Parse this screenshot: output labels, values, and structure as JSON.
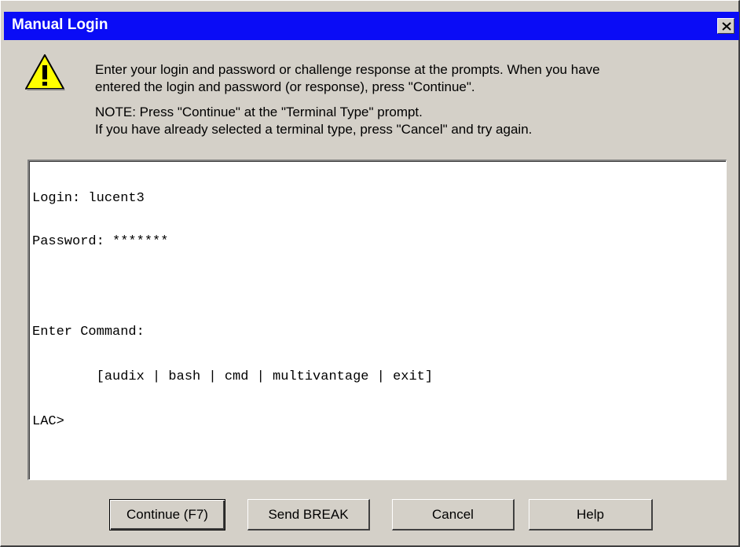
{
  "window": {
    "title": "Manual Login",
    "close_icon": "close-x-icon"
  },
  "message": {
    "icon": "warning-icon",
    "line1": "Enter your login and password or challenge response at the prompts. When you have",
    "line2": "entered the login and password (or response), press \"Continue\".",
    "line3": "NOTE: Press \"Continue\" at the \"Terminal Type\" prompt.",
    "line4": "If you have already selected a terminal type, press \"Cancel\" and try again."
  },
  "terminal": {
    "lines": [
      "Login: lucent3",
      "Password: *******",
      "Enter Command:",
      "        [audix | bash | cmd | multivantage | exit]",
      "LAC>"
    ]
  },
  "buttons": {
    "continue": "Continue (F7)",
    "send_break": "Send BREAK",
    "cancel": "Cancel",
    "help": "Help"
  },
  "colors": {
    "titlebar": "#0a0cf6",
    "dialog_face": "#d4d0c8",
    "warning_yellow": "#ffff00"
  }
}
